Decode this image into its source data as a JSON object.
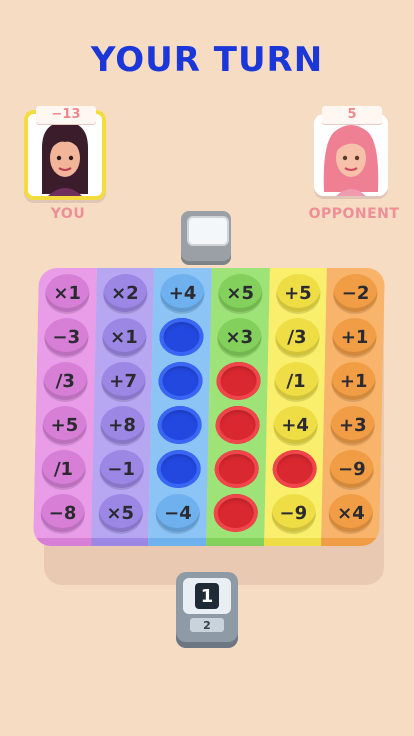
{
  "title": "YOUR TURN",
  "players": {
    "you": {
      "name": "YOU",
      "score": "−13"
    },
    "opponent": {
      "name": "OPPONENT",
      "score": "5"
    }
  },
  "board": {
    "columns": [
      {
        "color": "#e99de9",
        "edge": "#d77fd7",
        "cells": [
          "×1",
          "−3",
          "/3",
          "+5",
          "/1",
          "−8"
        ]
      },
      {
        "color": "#b7a6f2",
        "edge": "#9c87e4",
        "cells": [
          "×2",
          "×1",
          "+7",
          "+8",
          "−1",
          "×5"
        ]
      },
      {
        "color": "#8cc4f6",
        "edge": "#6fb0ee",
        "cells": [
          "+4",
          "●blue",
          "●blue",
          "●blue",
          "●blue",
          "−4"
        ]
      },
      {
        "color": "#9ee378",
        "edge": "#83d05c",
        "cells": [
          "×5",
          "×3",
          "●red",
          "●red",
          "●red",
          "●red"
        ]
      },
      {
        "color": "#f9ef6c",
        "edge": "#eedd45",
        "cells": [
          "+5",
          "/3",
          "/1",
          "+4",
          "●red",
          "−9"
        ]
      },
      {
        "color": "#f8b46a",
        "edge": "#f19d45",
        "cells": [
          "−2",
          "+1",
          "+1",
          "+3",
          "−9",
          "×4"
        ]
      }
    ]
  },
  "dice": {
    "top": "1",
    "bottom": "2"
  }
}
